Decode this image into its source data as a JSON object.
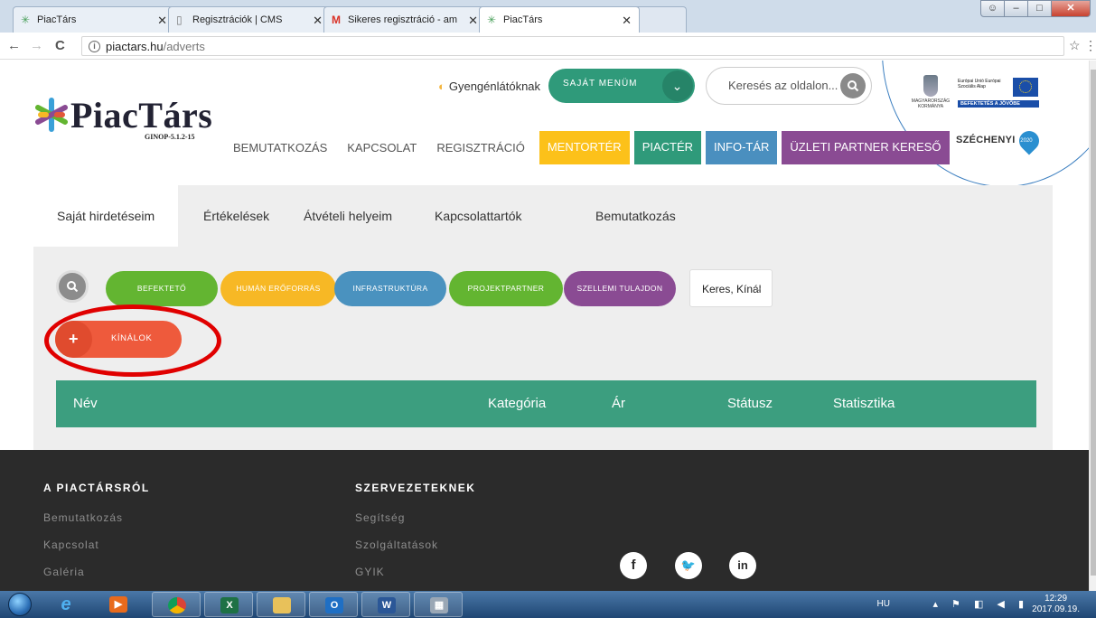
{
  "browser": {
    "tabs": [
      {
        "title": "PiacTárs",
        "icon": "piactars-favicon"
      },
      {
        "title": "Regisztrációk | CMS",
        "icon": "page-icon"
      },
      {
        "title": "Sikeres regisztráció - am",
        "icon": "gmail-icon"
      },
      {
        "title": "PiacTárs",
        "icon": "piactars-favicon"
      }
    ],
    "url_domain": "piactars.hu",
    "url_path": "/adverts"
  },
  "header": {
    "logo_text": "PiacTárs",
    "logo_sub": "GINOP-5.1.2-15",
    "accessibility_label": "Gyengénlátóknak",
    "menu_button": "SAJÁT MENÜM",
    "search_placeholder": "Keresés az oldalon...",
    "szechenyi": "SZÉCHENYI",
    "szechenyi_year": "2020",
    "eu_bar": "BEFEKTETÉS A JÖVŐBE",
    "eu_text": "Európai Unió Európai Szociális Alap",
    "gov_text": "MAGYARORSZÁG KORMÁNYA"
  },
  "nav": {
    "items": [
      {
        "label": "BEMUTATKOZÁS",
        "color": ""
      },
      {
        "label": "KAPCSOLAT",
        "color": ""
      },
      {
        "label": "REGISZTRÁCIÓ",
        "color": ""
      },
      {
        "label": "MENTORTÉR",
        "color": "#fcc11a"
      },
      {
        "label": "PIACTÉR",
        "color": "#2f9a7a"
      },
      {
        "label": "INFO-TÁR",
        "color": "#4a8fbf"
      },
      {
        "label": "ÜZLETI PARTNER KERESŐ",
        "color": "#8a4b93"
      }
    ]
  },
  "subtabs": [
    "Saját hirdetéseim",
    "Értékelések",
    "Átvételi helyeim",
    "Kapcsolattartók",
    "Bemutatkozás"
  ],
  "filters": {
    "pills": [
      {
        "label": "BEFEKTETŐ",
        "color": "#63b531"
      },
      {
        "label": "HUMÁN ERŐFORRÁS",
        "color": "#f7b825"
      },
      {
        "label": "INFRASTRUKTÚRA",
        "color": "#4a92bf"
      },
      {
        "label": "PROJEKTPARTNER",
        "color": "#63b531"
      },
      {
        "label": "SZELLEMI TULAJDON",
        "color": "#8a4b93"
      }
    ],
    "select_value": "Keres, Kínál"
  },
  "add_button": "KÍNÁLOK",
  "table": {
    "columns": [
      "Név",
      "Kategória",
      "Ár",
      "Státusz",
      "Statisztika"
    ]
  },
  "footer": {
    "col1_head": "A PIACTÁRSRÓL",
    "col1_links": [
      "Bemutatkozás",
      "Kapcsolat",
      "Galéria"
    ],
    "col2_head": "SZERVEZETEKNEK",
    "col2_links": [
      "Segítség",
      "Szolgáltatások",
      "GYIK"
    ],
    "social": [
      "facebook-icon",
      "twitter-icon",
      "linkedin-icon"
    ]
  },
  "taskbar": {
    "lang": "HU",
    "time": "12:29",
    "date": "2017.09.19."
  }
}
